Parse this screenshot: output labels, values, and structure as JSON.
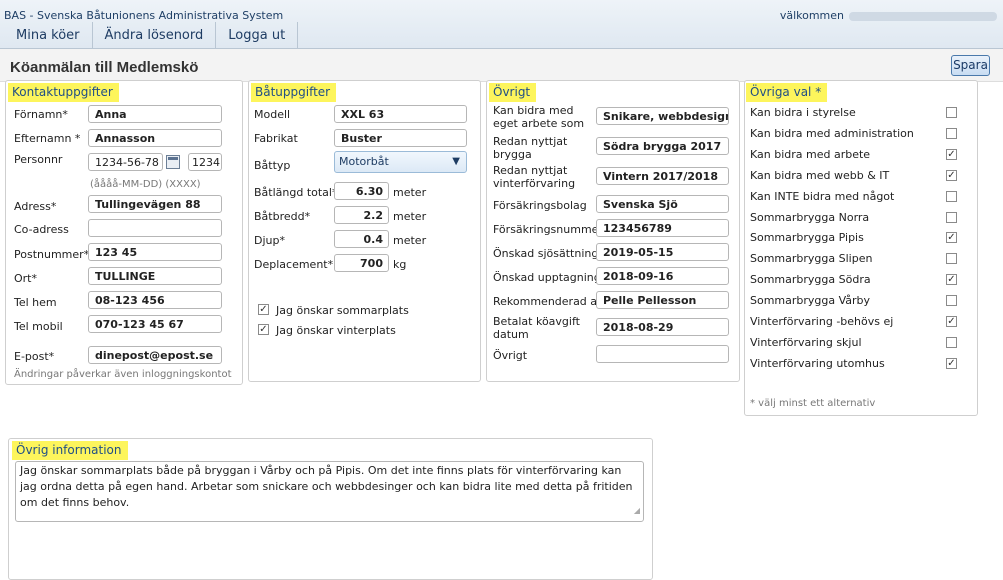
{
  "header": {
    "app_title": "BAS - Svenska Båtunionens Administrativa System",
    "welcome": "välkommen",
    "menu": [
      "Mina köer",
      "Ändra lösenord",
      "Logga ut"
    ]
  },
  "page": {
    "title": "Köanmälan till Medlemskö",
    "save_label": "Spara"
  },
  "kontakt": {
    "heading": "Kontaktuppgifter",
    "fornamn": {
      "label": "Förnamn*",
      "value": "Anna"
    },
    "efternamn": {
      "label": "Efternamn *",
      "value": "Annasson"
    },
    "personnr": {
      "label": "Personnr",
      "value": "1234-56-78",
      "value2": "1234",
      "hint": "(åååå-MM-DD) (XXXX)"
    },
    "adress": {
      "label": "Adress*",
      "value": "Tullingevägen 88"
    },
    "coadress": {
      "label": "Co-adress",
      "value": ""
    },
    "postnummer": {
      "label": "Postnummer*",
      "value": "123 45"
    },
    "ort": {
      "label": "Ort*",
      "value": "TULLINGE"
    },
    "telhem": {
      "label": "Tel hem",
      "value": "08-123 456"
    },
    "telmobil": {
      "label": "Tel mobil",
      "value": "070-123 45 67"
    },
    "epost": {
      "label": "E-post*",
      "value": "dinepost@epost.se"
    },
    "note": "Ändringar påverkar även inloggningskontot"
  },
  "bat": {
    "heading": "Båtuppgifter",
    "modell": {
      "label": "Modell",
      "value": "XXL 63"
    },
    "fabrikat": {
      "label": "Fabrikat",
      "value": "Buster"
    },
    "battyp": {
      "label": "Båttyp",
      "value": "Motorbåt"
    },
    "langd": {
      "label": "Båtlängd total*",
      "value": "6.30",
      "unit": "meter"
    },
    "bredd": {
      "label": "Båtbredd*",
      "value": "2.2",
      "unit": "meter"
    },
    "djup": {
      "label": "Djup*",
      "value": "0.4",
      "unit": "meter"
    },
    "deplacement": {
      "label": "Deplacement*",
      "value": "700",
      "unit": "kg"
    },
    "sommarplats": {
      "label": "Jag önskar sommarplats",
      "checked": true
    },
    "vinterplats": {
      "label": "Jag önskar vinterplats",
      "checked": true
    }
  },
  "ovrigt": {
    "heading": "Övrigt",
    "arbete": {
      "label": "Kan bidra med eget arbete som",
      "value": "Snikare, webbdesign"
    },
    "brygga": {
      "label": "Redan nyttjat brygga",
      "value": "Södra brygga 2017"
    },
    "vinter": {
      "label": "Redan nyttjat vinterförvaring",
      "value": "Vintern 2017/2018"
    },
    "forsakringsbolag": {
      "label": "Försäkringsbolag",
      "value": "Svenska Sjö"
    },
    "forsakringsnummer": {
      "label": "Försäkringsnummer",
      "value": "123456789"
    },
    "sjosattning": {
      "label": "Önskad sjösättning",
      "value": "2019-05-15"
    },
    "upptagning": {
      "label": "Önskad upptagning",
      "value": "2018-09-16"
    },
    "rekommenderad": {
      "label": "Rekommenderad av",
      "value": "Pelle Pellesson"
    },
    "koavgift": {
      "label": "Betalat köavgift datum",
      "value": "2018-08-29"
    },
    "ovrigt": {
      "label": "Övrigt",
      "value": ""
    }
  },
  "val": {
    "heading": "Övriga val *",
    "items": [
      {
        "label": "Kan bidra i styrelse",
        "checked": false
      },
      {
        "label": "Kan bidra med administration",
        "checked": false
      },
      {
        "label": "Kan bidra med arbete",
        "checked": true
      },
      {
        "label": "Kan bidra med webb & IT",
        "checked": true
      },
      {
        "label": "Kan INTE bidra med något",
        "checked": false
      },
      {
        "label": "Sommarbrygga Norra",
        "checked": false
      },
      {
        "label": "Sommarbrygga Pipis",
        "checked": true
      },
      {
        "label": "Sommarbrygga Slipen",
        "checked": false
      },
      {
        "label": "Sommarbrygga Södra",
        "checked": true
      },
      {
        "label": "Sommarbrygga Vårby",
        "checked": false
      },
      {
        "label": "Vinterförvaring -behövs ej",
        "checked": true
      },
      {
        "label": "Vinterförvaring skjul",
        "checked": false
      },
      {
        "label": "Vinterförvaring utomhus",
        "checked": true
      }
    ],
    "note": "* välj minst ett alternativ"
  },
  "info": {
    "heading": "Övrig information",
    "text": "Jag önskar sommarplats både på bryggan i Vårby och på Pipis. Om det inte finns plats för vinterförvaring kan jag ordna detta på egen hand. Arbetar som snickare och webbdesinger och kan bidra lite med detta på fritiden om det finns behov."
  }
}
